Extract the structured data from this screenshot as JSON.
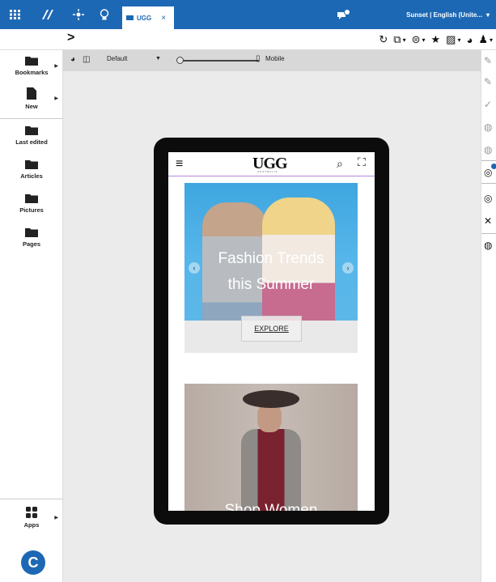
{
  "topbar": {
    "tab_label": "UGG",
    "tab_close": "×",
    "site_info": "Sunset | English (Unite...",
    "site_info_arrow": "▾"
  },
  "toolbar": {
    "chevron": ">",
    "colors": {
      "accent": "#1d68b4"
    }
  },
  "sidebar": {
    "items": [
      {
        "label": "Bookmarks"
      },
      {
        "label": "New"
      },
      {
        "label": "Last edited"
      },
      {
        "label": "Articles"
      },
      {
        "label": "Pictures"
      },
      {
        "label": "Pages"
      },
      {
        "label": "Apps"
      }
    ]
  },
  "preview_toolbar": {
    "device_preset": "Default",
    "mobile_label": "Mobile"
  },
  "phone": {
    "header": {
      "brand": "UGG",
      "brand_sub": "AUSTRALIA"
    },
    "hero": {
      "title_line1": "Fashion Trends",
      "title_line2": "this Summer",
      "cta": "EXPLORE"
    },
    "promo": {
      "title": "Shop Women"
    }
  }
}
